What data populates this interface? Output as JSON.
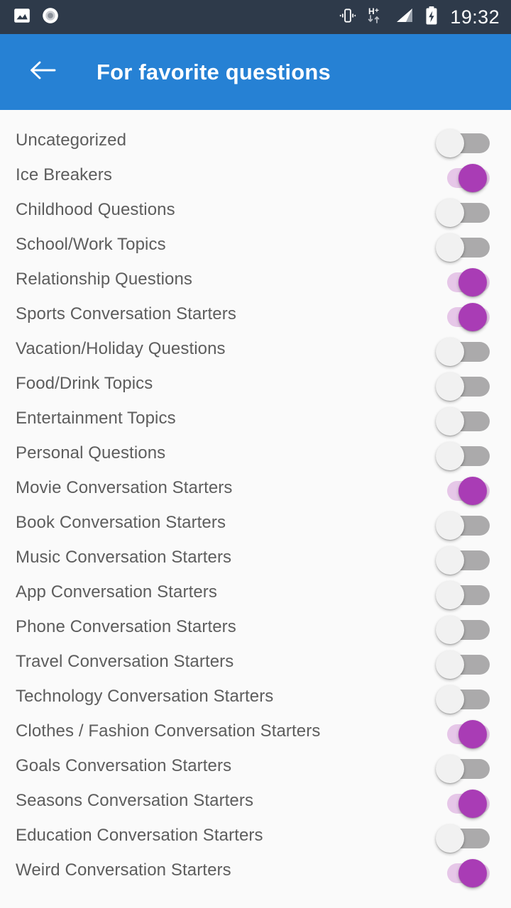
{
  "status_bar": {
    "background": "#2e3a4a",
    "left_icons": [
      {
        "name": "image-icon",
        "label": "Photo"
      },
      {
        "name": "record-circle-icon",
        "label": "Recorder"
      }
    ],
    "right_icons": [
      {
        "name": "vibrate-icon",
        "label": "Vibrate"
      },
      {
        "name": "network-hplus-icon",
        "label": "H+"
      },
      {
        "name": "signal-bars-icon",
        "label": "Signal"
      },
      {
        "name": "battery-charging-icon",
        "label": "Charging"
      }
    ],
    "network_label": "H+",
    "time": "19:32"
  },
  "app_bar": {
    "background": "#2681d4",
    "back_icon": "arrow-left-icon",
    "title": "For favorite questions"
  },
  "colors": {
    "page_background": "#fafafa",
    "row_text": "#5d5d5d",
    "switch_on_thumb": "#a93cb5",
    "switch_on_track": "#e6c7e8",
    "switch_off_thumb": "#f1f1f1",
    "switch_off_track": "#abaaab"
  },
  "list": {
    "items": [
      {
        "label": "Uncategorized",
        "enabled": false
      },
      {
        "label": "Ice Breakers",
        "enabled": true
      },
      {
        "label": "Childhood Questions",
        "enabled": false
      },
      {
        "label": "School/Work Topics",
        "enabled": false
      },
      {
        "label": "Relationship Questions",
        "enabled": true
      },
      {
        "label": "Sports Conversation Starters",
        "enabled": true
      },
      {
        "label": "Vacation/Holiday Questions",
        "enabled": false
      },
      {
        "label": "Food/Drink Topics",
        "enabled": false
      },
      {
        "label": "Entertainment Topics",
        "enabled": false
      },
      {
        "label": "Personal Questions",
        "enabled": false
      },
      {
        "label": "Movie Conversation Starters",
        "enabled": true
      },
      {
        "label": "Book Conversation Starters",
        "enabled": false
      },
      {
        "label": "Music Conversation Starters",
        "enabled": false
      },
      {
        "label": "App Conversation Starters",
        "enabled": false
      },
      {
        "label": "Phone Conversation Starters",
        "enabled": false
      },
      {
        "label": "Travel Conversation Starters",
        "enabled": false
      },
      {
        "label": "Technology Conversation Starters",
        "enabled": false
      },
      {
        "label": "Clothes / Fashion Conversation Starters",
        "enabled": true
      },
      {
        "label": "Goals Conversation Starters",
        "enabled": false
      },
      {
        "label": "Seasons Conversation Starters",
        "enabled": true
      },
      {
        "label": "Education Conversation Starters",
        "enabled": false
      },
      {
        "label": "Weird Conversation Starters",
        "enabled": true
      }
    ]
  }
}
